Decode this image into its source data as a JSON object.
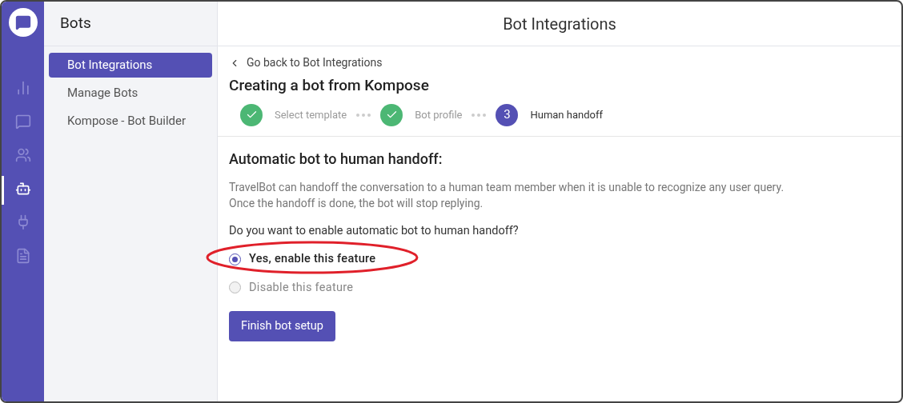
{
  "rail": [
    {
      "kind": "chart",
      "selected": false
    },
    {
      "kind": "chat",
      "selected": false
    },
    {
      "kind": "users",
      "selected": false
    },
    {
      "kind": "bot",
      "selected": true
    },
    {
      "kind": "plug",
      "selected": false
    },
    {
      "kind": "doc",
      "selected": false
    }
  ],
  "sidebar": {
    "title": "Bots",
    "items": [
      {
        "label": "Bot Integrations",
        "selected": true
      },
      {
        "label": "Manage Bots",
        "selected": false
      },
      {
        "label": "Kompose - Bot Builder",
        "selected": false
      }
    ]
  },
  "header": {
    "title": "Bot Integrations"
  },
  "back_link": "Go back to Bot Integrations",
  "page_title": "Creating a bot from Kompose",
  "steps": [
    {
      "kind": "done",
      "label": "Select template"
    },
    {
      "kind": "done",
      "label": "Bot profile"
    },
    {
      "kind": "current",
      "number": "3",
      "label": "Human handoff"
    }
  ],
  "section": {
    "title": "Automatic bot to human handoff:",
    "description_lines": [
      "TravelBot can handoff the conversation to a human team member when it is unable to recognize any user query.",
      "Once the handoff is done, the bot will stop replying."
    ],
    "question": "Do you want to enable automatic bot to human handoff?",
    "options": [
      {
        "label": "Yes, enable this feature",
        "selected": true
      },
      {
        "label": "Disable this feature",
        "selected": false
      }
    ],
    "button": "Finish bot setup"
  }
}
